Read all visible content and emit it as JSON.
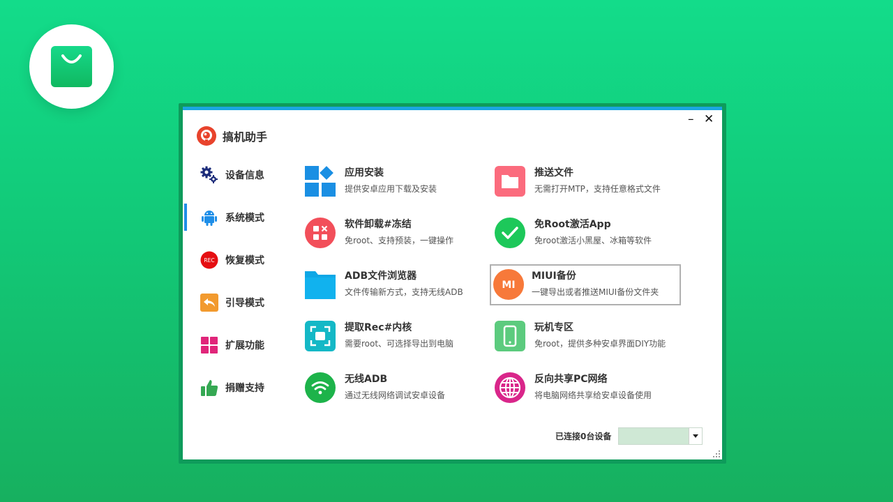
{
  "window": {
    "title": "搞机助手",
    "min_glyph": "–",
    "close_glyph": "✕"
  },
  "sidebar": {
    "items": [
      {
        "label": "设备信息",
        "icon": "gears-icon",
        "active": false
      },
      {
        "label": "系统模式",
        "icon": "android-icon",
        "active": true
      },
      {
        "label": "恢复模式",
        "icon": "rec-icon",
        "active": false,
        "badge": "REC"
      },
      {
        "label": "引导模式",
        "icon": "reply-arrow-icon",
        "active": false
      },
      {
        "label": "扩展功能",
        "icon": "grid-icon",
        "active": false
      },
      {
        "label": "捐赠支持",
        "icon": "thumbs-up-icon",
        "active": false
      }
    ]
  },
  "features": [
    {
      "name": "应用安装",
      "desc": "提供安卓应用下载及安装",
      "icon": "app-grid-icon",
      "color": "#1a8fe3"
    },
    {
      "name": "推送文件",
      "desc": "无需打开MTP，支持任意格式文件",
      "icon": "folder-icon",
      "color": "#fb6b7d"
    },
    {
      "name": "软件卸载#冻结",
      "desc": "免root、支持预装，一键操作",
      "icon": "uninstall-icon",
      "color": "#f24f5a"
    },
    {
      "name": "免Root激活App",
      "desc": "免root激活小黑屋、冰箱等软件",
      "icon": "checkmark-icon",
      "color": "#1dc85a"
    },
    {
      "name": "ADB文件浏览器",
      "desc": "文件传输新方式，支持无线ADB",
      "icon": "folder-blue-icon",
      "color": "#11b2ee"
    },
    {
      "name": "MIUI备份",
      "desc": "一键导出或者推送MIUI备份文件夹",
      "icon": "mi-logo-icon",
      "color": "#f7793a",
      "mi_text": "MI"
    },
    {
      "name": "提取Rec#内核",
      "desc": "需要root、可选择导出到电脑",
      "icon": "scan-icon",
      "color": "#14b8c6"
    },
    {
      "name": "玩机专区",
      "desc": "免root，提供多种安卓界面DIY功能",
      "icon": "phone-icon",
      "color": "#5ccb7e"
    },
    {
      "name": "无线ADB",
      "desc": "通过无线网络调试安卓设备",
      "icon": "wifi-icon",
      "color": "#1db34a"
    },
    {
      "name": "反向共享PC网络",
      "desc": "将电脑网络共享给安卓设备使用",
      "icon": "globe-icon",
      "color": "#d9268a"
    }
  ],
  "status": {
    "text": "已连接0台设备",
    "selected_device": ""
  },
  "colors": {
    "accent": "#1aa6e0",
    "background": "#13d286",
    "active_indicator": "#1e8ee8"
  }
}
